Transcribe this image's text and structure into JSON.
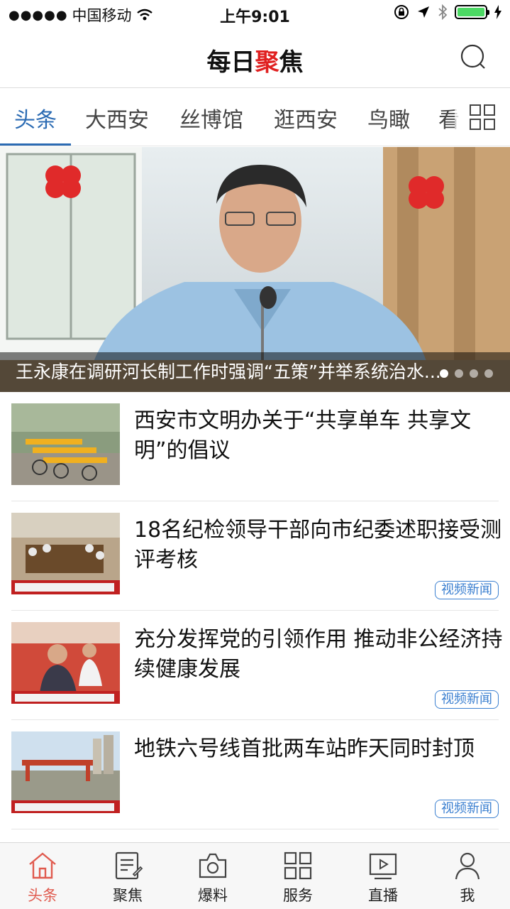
{
  "status_bar": {
    "signal": "●●●●●",
    "carrier": "中国移动",
    "time": "上午9:01"
  },
  "header": {
    "title_part1": "每日",
    "title_part2": "聚",
    "title_part3": "焦",
    "accent_color": "#e02020"
  },
  "tabs": [
    {
      "label": "头条",
      "active": true
    },
    {
      "label": "大西安"
    },
    {
      "label": "丝博馆"
    },
    {
      "label": "逛西安"
    },
    {
      "label": "鸟瞰"
    },
    {
      "label": "看"
    }
  ],
  "banner": {
    "caption": "王永康在调研河长制工作时强调“五策”并举系统治水...",
    "slide_count": 4,
    "active_slide": 1
  },
  "news": [
    {
      "title": "西安市文明办关于“共享单车 共享文明”的倡议",
      "tag": ""
    },
    {
      "title": "18名纪检领导干部向市纪委述职接受测评考核",
      "tag": "视频新闻"
    },
    {
      "title": "充分发挥党的引领作用 推动非公经济持续健康发展",
      "tag": "视频新闻"
    },
    {
      "title": "地铁六号线首批两车站昨天同时封顶",
      "tag": "视频新闻"
    }
  ],
  "tabbar": [
    {
      "label": "头条",
      "icon": "home-icon",
      "active": true
    },
    {
      "label": "聚焦",
      "icon": "focus-list-icon"
    },
    {
      "label": "爆料",
      "icon": "camera-icon"
    },
    {
      "label": "服务",
      "icon": "grid-icon"
    },
    {
      "label": "直播",
      "icon": "live-play-icon"
    },
    {
      "label": "我",
      "icon": "user-icon"
    }
  ],
  "colors": {
    "tab_active": "#2b6bb3",
    "tag": "#3a7fd0",
    "tabbar_active": "#e05a4e"
  }
}
